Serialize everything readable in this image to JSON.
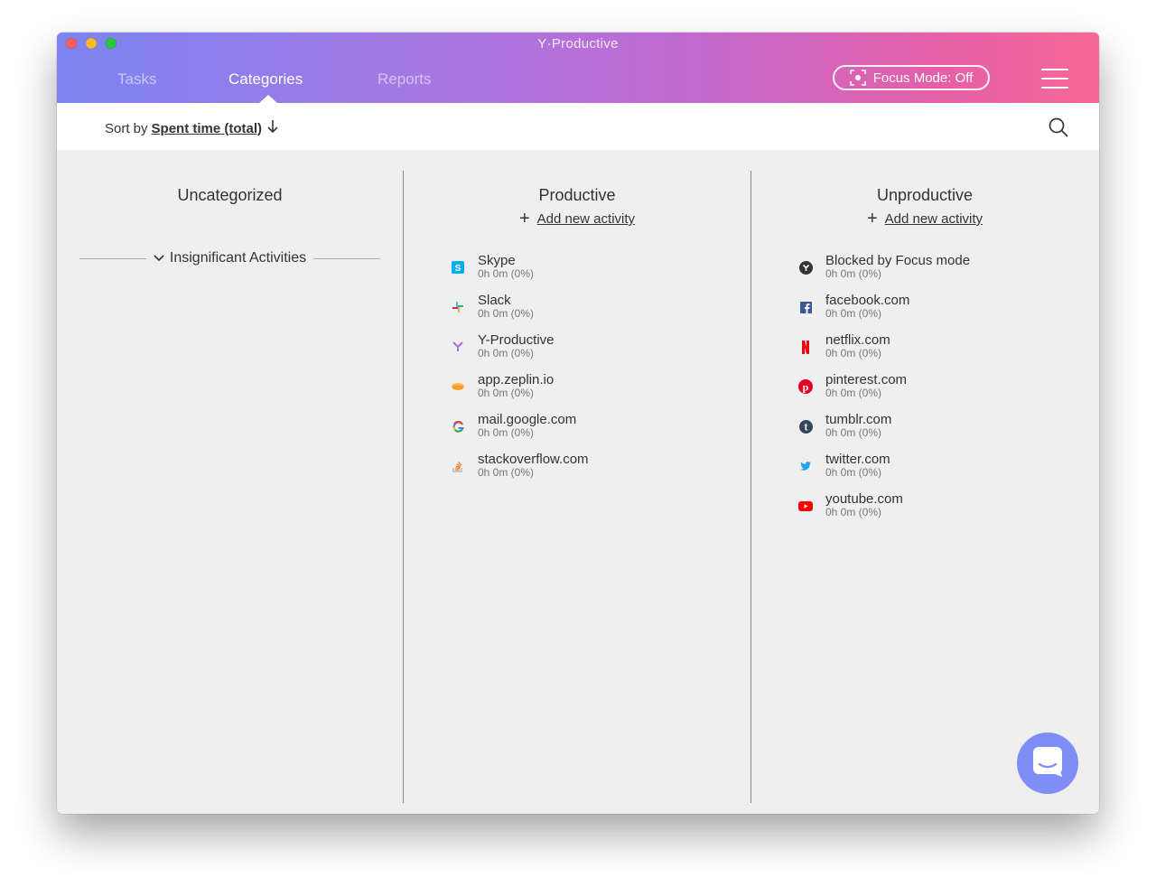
{
  "window": {
    "title": "Y·Productive"
  },
  "tabs": [
    {
      "label": "Tasks"
    },
    {
      "label": "Categories"
    },
    {
      "label": "Reports"
    }
  ],
  "focus_button": {
    "label": "Focus Mode: Off"
  },
  "sort": {
    "prefix": "Sort by",
    "value": "Spent time (total)",
    "direction": "descending"
  },
  "columns": {
    "uncategorized": {
      "title": "Uncategorized",
      "group_label": "Insignificant Activities"
    },
    "productive": {
      "title": "Productive",
      "add_label": "Add new activity",
      "items": [
        {
          "name": "Skype",
          "time": "0h 0m (0%)",
          "icon": "skype-icon"
        },
        {
          "name": "Slack",
          "time": "0h 0m (0%)",
          "icon": "slack-icon"
        },
        {
          "name": "Y-Productive",
          "time": "0h 0m (0%)",
          "icon": "y-productive-icon"
        },
        {
          "name": "app.zeplin.io",
          "time": "0h 0m (0%)",
          "icon": "zeplin-icon"
        },
        {
          "name": "mail.google.com",
          "time": "0h 0m (0%)",
          "icon": "google-icon"
        },
        {
          "name": "stackoverflow.com",
          "time": "0h 0m (0%)",
          "icon": "stackoverflow-icon"
        }
      ]
    },
    "unproductive": {
      "title": "Unproductive",
      "add_label": "Add new activity",
      "items": [
        {
          "name": "Blocked by Focus mode",
          "time": "0h 0m (0%)",
          "icon": "focus-block-icon"
        },
        {
          "name": "facebook.com",
          "time": "0h 0m (0%)",
          "icon": "facebook-icon"
        },
        {
          "name": "netflix.com",
          "time": "0h 0m (0%)",
          "icon": "netflix-icon"
        },
        {
          "name": "pinterest.com",
          "time": "0h 0m (0%)",
          "icon": "pinterest-icon"
        },
        {
          "name": "tumblr.com",
          "time": "0h 0m (0%)",
          "icon": "tumblr-icon"
        },
        {
          "name": "twitter.com",
          "time": "0h 0m (0%)",
          "icon": "twitter-icon"
        },
        {
          "name": "youtube.com",
          "time": "0h 0m (0%)",
          "icon": "youtube-icon"
        }
      ]
    }
  },
  "colors": {
    "gradient_start": "#7b84f1",
    "gradient_end": "#f66895",
    "chat_button": "#7f8ef6"
  }
}
